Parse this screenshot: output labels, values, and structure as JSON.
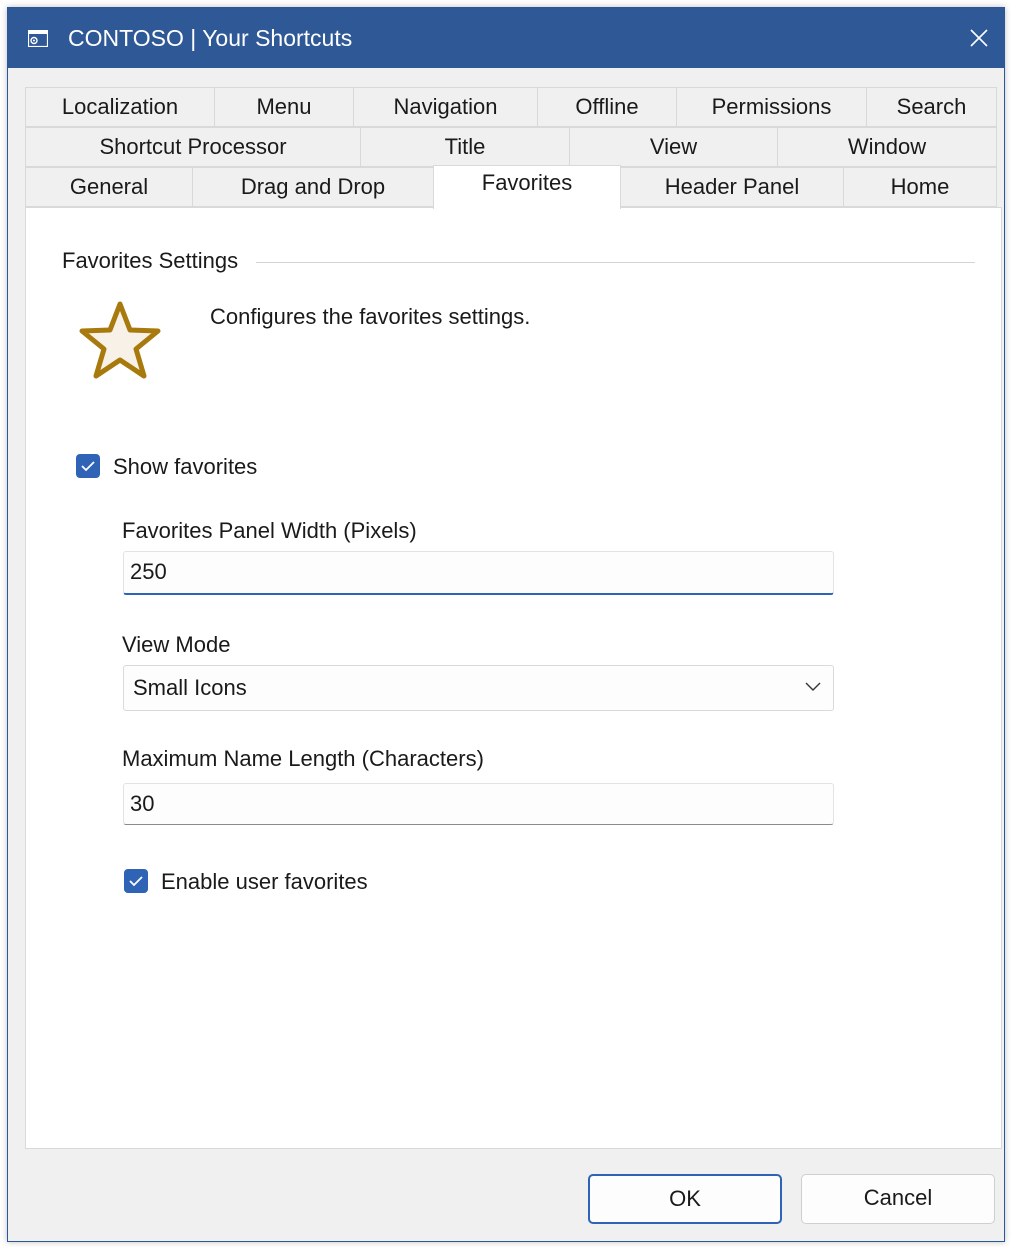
{
  "window": {
    "title": "CONTOSO | Your Shortcuts",
    "app_icon": "settings-window-icon",
    "close_icon": "close-icon",
    "accent_color": "#2f5897"
  },
  "tabs": {
    "row1": [
      "Localization",
      "Menu",
      "Navigation",
      "Offline",
      "Permissions",
      "Search"
    ],
    "row2": [
      "Shortcut Processor",
      "Title",
      "View",
      "Window"
    ],
    "row3": [
      "General",
      "Drag and Drop",
      "Favorites",
      "Header Panel",
      "Home"
    ],
    "active": "Favorites"
  },
  "favorites": {
    "group_title": "Favorites Settings",
    "icon": "star-icon",
    "description": "Configures the favorites settings.",
    "show_favorites": {
      "label": "Show favorites",
      "checked": true
    },
    "panel_width": {
      "label": "Favorites Panel Width (Pixels)",
      "value": "250"
    },
    "view_mode": {
      "label": "View Mode",
      "value": "Small Icons"
    },
    "max_name_length": {
      "label": "Maximum Name Length (Characters)",
      "value": "30"
    },
    "enable_user_favorites": {
      "label": "Enable user favorites",
      "checked": true
    }
  },
  "buttons": {
    "ok": "OK",
    "cancel": "Cancel"
  }
}
